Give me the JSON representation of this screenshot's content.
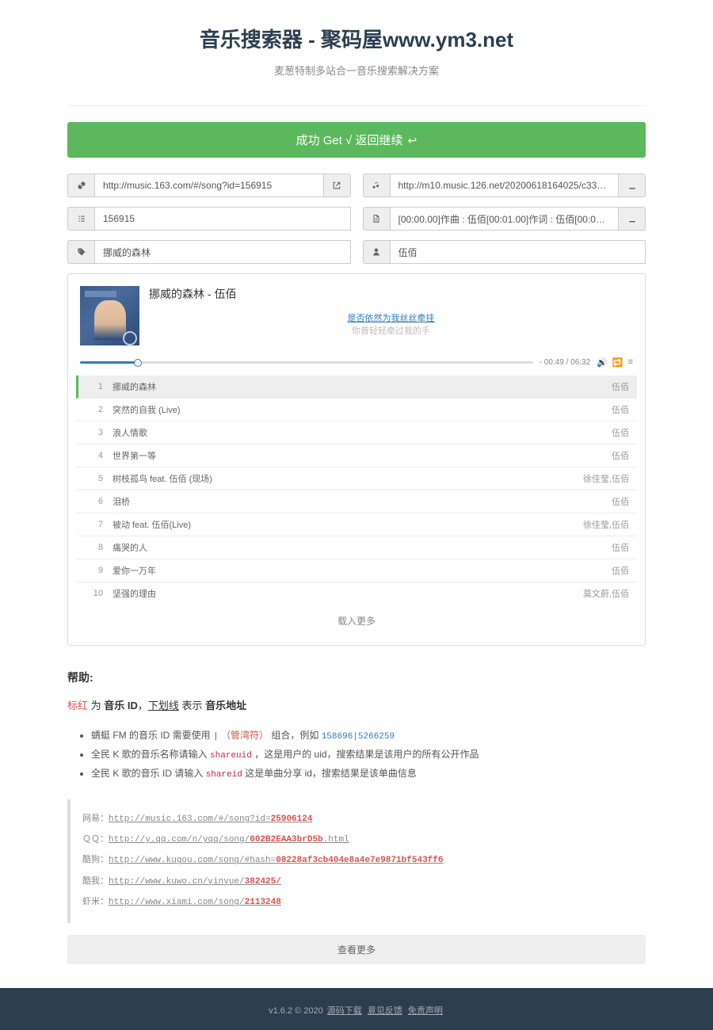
{
  "header": {
    "title": "音乐搜索器 - 聚码屋www.ym3.net",
    "subtitle": "麦葱特制多站合一音乐搜索解决方案"
  },
  "success": {
    "text": "成功 Get √ 返回继续 "
  },
  "fields": {
    "url": "http://music.163.com/#/song?id=156915",
    "mp3": "http://m10.music.126.net/20200618164025/c3382...",
    "id": "156915",
    "lrc": "[00:00.00]作曲 : 伍佰[00:01.00]作词 : 伍佰[00:02.00...",
    "name": "挪威的森林",
    "artist": "伍佰"
  },
  "player": {
    "title": "挪威的森林 - 伍佰",
    "lyric_active": "是否依然为我丝丝牵挂",
    "lyric_inactive": "你曾轻轻牵过我的手",
    "time": "- 00:49 / 06:32"
  },
  "playlist": [
    {
      "n": "1",
      "t": "挪威的森林",
      "a": "伍佰"
    },
    {
      "n": "2",
      "t": "突然的自我 (Live)",
      "a": "伍佰"
    },
    {
      "n": "3",
      "t": "浪人情歌",
      "a": "伍佰"
    },
    {
      "n": "4",
      "t": "世界第一等",
      "a": "伍佰"
    },
    {
      "n": "5",
      "t": "树枝孤鸟 feat. 伍佰 (现场)",
      "a": "徐佳莹,伍佰"
    },
    {
      "n": "6",
      "t": "泪桥",
      "a": "伍佰"
    },
    {
      "n": "7",
      "t": "被动 feat. 伍佰(Live)",
      "a": "徐佳莹,伍佰"
    },
    {
      "n": "8",
      "t": "痛哭的人",
      "a": "伍佰"
    },
    {
      "n": "9",
      "t": "爱你一万年",
      "a": "伍佰"
    },
    {
      "n": "10",
      "t": "坚强的理由",
      "a": "莫文蔚,伍佰"
    }
  ],
  "load_more": "载入更多",
  "help": {
    "title": "帮助:",
    "legend_red": "标红",
    "legend_1": " 为 ",
    "legend_id": "音乐 ID",
    "legend_2": "，",
    "legend_ul": "下划线",
    "legend_3": " 表示 ",
    "legend_addr": "音乐地址",
    "li1_a": "蜻蜓 FM 的音乐 ID 需要使用",
    "li1_b": "（管湾符）",
    "li1_c": "组合，例如",
    "li1_d": "158696|5266259",
    "li2_a": "全民 K 歌的音乐名称请输入",
    "li2_b": "shareuid",
    "li2_c": "，这是用户的 uid，搜索结果是该用户的所有公开作品",
    "li3_a": "全民 K 歌的音乐 ID 请输入",
    "li3_b": "shareid",
    "li3_c": " 这是单曲分享 id，搜索结果是该单曲信息",
    "ex": [
      {
        "label": "网易：",
        "url": "http://music.163.com/#/song?id=",
        "hl": "25906124"
      },
      {
        "label": "ＱＱ：",
        "url": "http://y.qq.com/n/yqq/song/",
        "hl": "002B2EAA3brD5b",
        "suf": ".html"
      },
      {
        "label": "酷狗：",
        "url": "http://www.kugou.com/song/#hash=",
        "hl": "08228af3cb404e8a4e7e9871bf543ff6"
      },
      {
        "label": "酷我：",
        "url": "http://www.kuwo.cn/yinyue/",
        "hl": "382425/"
      },
      {
        "label": "虾米：",
        "url": "http://www.xiami.com/song/",
        "hl": "2113248"
      }
    ]
  },
  "show_more": "查看更多",
  "footer": {
    "ver": "v1.6.2 © 2020 ",
    "l1": "源码下载",
    "l2": "意见反馈",
    "l3": "免责声明"
  }
}
